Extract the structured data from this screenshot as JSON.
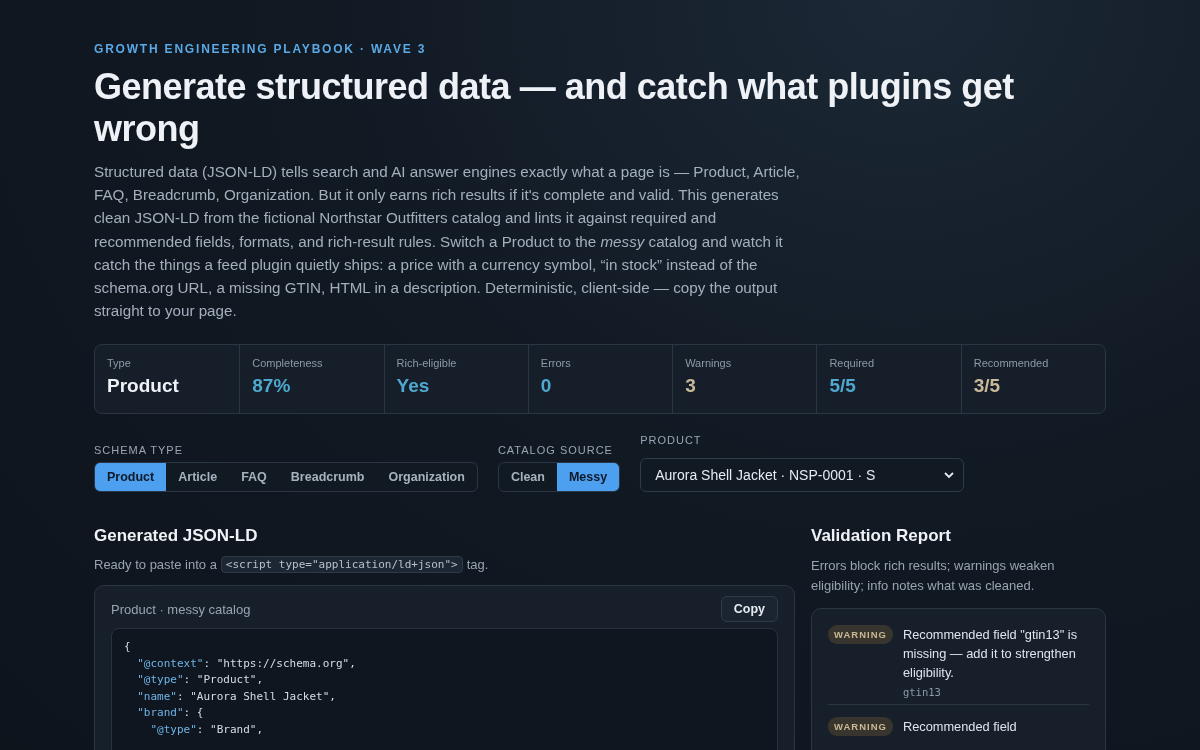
{
  "eyebrow": "GROWTH ENGINEERING PLAYBOOK · WAVE 3",
  "title": "Generate structured data — and catch what plugins get wrong",
  "description": "Structured data (JSON-LD) tells search and AI answer engines exactly what a page is — Product, Article, FAQ, Breadcrumb, Organization. But it only earns rich results if it's complete and valid. This generates clean JSON-LD from the fictional Northstar Outfitters catalog and lints it against required and recommended fields, formats, and rich-result rules. Switch a Product to the *messy* catalog and watch it catch the things a feed plugin quietly ships: a price with a currency symbol, “in stock” instead of the schema.org URL, a missing GTIN, HTML in a description. Deterministic, client-side — copy the output straight to your page.",
  "stats": [
    {
      "label": "Type",
      "value": "Product",
      "color": "#eef2f6"
    },
    {
      "label": "Completeness",
      "value": "87%",
      "color": "#4fa9cf"
    },
    {
      "label": "Rich-eligible",
      "value": "Yes",
      "color": "#4fa9cf"
    },
    {
      "label": "Errors",
      "value": "0",
      "color": "#4fa9cf"
    },
    {
      "label": "Warnings",
      "value": "3",
      "color": "#c9b99a"
    },
    {
      "label": "Required",
      "value": "5/5",
      "color": "#4fa9cf"
    },
    {
      "label": "Recommended",
      "value": "3/5",
      "color": "#c9b99a"
    }
  ],
  "schema_type": {
    "label": "SCHEMA TYPE",
    "options": [
      {
        "label": "Product",
        "selected": true
      },
      {
        "label": "Article",
        "selected": false
      },
      {
        "label": "FAQ",
        "selected": false
      },
      {
        "label": "Breadcrumb",
        "selected": false
      },
      {
        "label": "Organization",
        "selected": false
      }
    ]
  },
  "catalog_source": {
    "label": "CATALOG SOURCE",
    "options": [
      {
        "label": "Clean",
        "selected": false
      },
      {
        "label": "Messy",
        "selected": true
      }
    ]
  },
  "product": {
    "label": "PRODUCT",
    "value": "Aurora Shell Jacket · NSP-0001 · S"
  },
  "generated": {
    "heading": "Generated JSON-LD",
    "hint_before": "Ready to paste into a",
    "hint_code": "<script type=\"application/ld+json\">",
    "hint_after": "tag.",
    "card_title": "Product · messy catalog",
    "copy": "Copy",
    "code_lines": [
      "{",
      "  \"@context\": \"https://schema.org\",",
      "  \"@type\": \"Product\",",
      "  \"name\": \"Aurora Shell Jacket\",",
      "  \"brand\": {",
      "    \"@type\": \"Brand\","
    ]
  },
  "validation": {
    "heading": "Validation Report",
    "subtitle": "Errors block rich results; warnings weaken eligibility; info notes what was cleaned.",
    "issues": [
      {
        "level": "WARNING",
        "kind": "warning",
        "message": "Recommended field \"gtin13\" is missing — add it to strengthen eligibility.",
        "field": "gtin13"
      },
      {
        "level": "WARNING",
        "kind": "warning",
        "message": "Recommended field"
      }
    ]
  }
}
